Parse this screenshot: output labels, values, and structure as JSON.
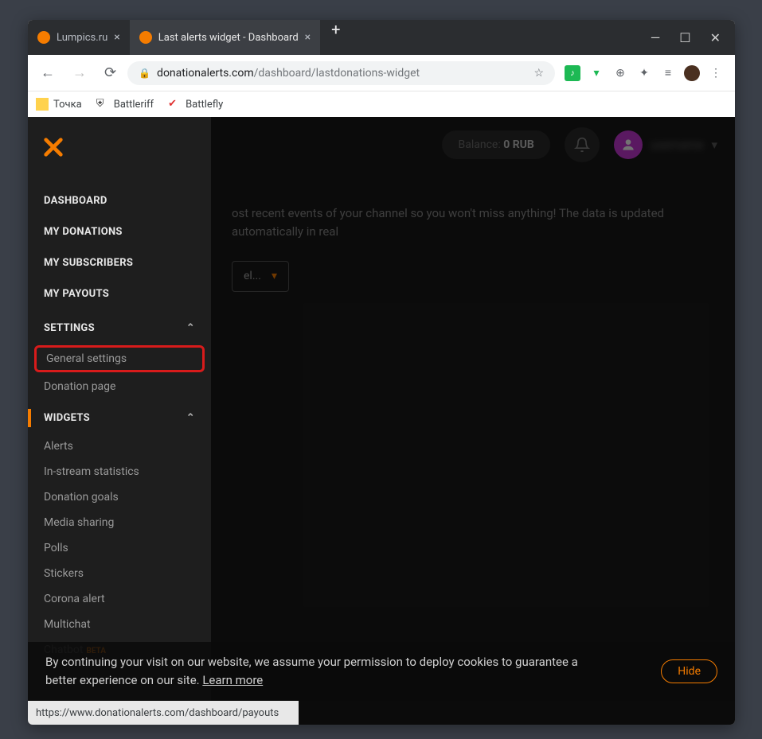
{
  "browser": {
    "tabs": [
      {
        "title": "Lumpics.ru",
        "fav_color": "#f57c00",
        "active": false
      },
      {
        "title": "Last alerts widget - Dashboard",
        "fav_color": "#f57c00",
        "active": true
      }
    ],
    "url_domain": "donationalerts.com",
    "url_path": "/dashboard/lastdonations-widget",
    "bookmarks": [
      {
        "label": "Точка"
      },
      {
        "label": "Battleriff"
      },
      {
        "label": "Battlefly"
      }
    ],
    "status_url": "https://www.donationalerts.com/dashboard/payouts"
  },
  "header": {
    "balance_label": "Balance:",
    "balance_value": "0 RUB",
    "username_blur": "username"
  },
  "main": {
    "desc": "ost recent events of your channel so you won't miss anything! The data is updated automatically in real",
    "dropdown_label": "el..."
  },
  "sidebar": {
    "main": [
      {
        "label": "Dashboard"
      },
      {
        "label": "My donations"
      },
      {
        "label": "My subscribers"
      },
      {
        "label": "My payouts"
      }
    ],
    "settings_label": "Settings",
    "settings_items": [
      {
        "label": "General settings",
        "highlight": true
      },
      {
        "label": "Donation page"
      }
    ],
    "widgets_label": "Widgets",
    "widgets_items": [
      {
        "label": "Alerts"
      },
      {
        "label": "In-stream statistics"
      },
      {
        "label": "Donation goals"
      },
      {
        "label": "Media sharing"
      },
      {
        "label": "Polls"
      },
      {
        "label": "Stickers"
      },
      {
        "label": "Corona alert"
      },
      {
        "label": "Multichat"
      }
    ],
    "chatbot_label": "Chatbot",
    "beta_label": "BETA"
  },
  "cookies": {
    "line1": "By continuing your visit on our website, we assume your permission to deploy cookies to guarantee a",
    "line2": "better experience on our site.",
    "learn": "Learn more",
    "hide": "Hide"
  }
}
